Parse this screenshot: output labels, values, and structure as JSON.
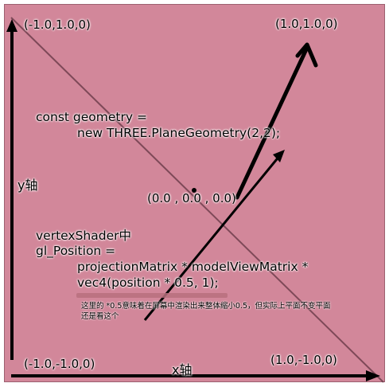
{
  "corners": {
    "top_left": "(-1.0,1.0,0)",
    "top_right": "(1.0,1.0,0)",
    "bottom_left": "(-1.0,-1.0,0)",
    "bottom_right": "(1.0,-1.0,0)"
  },
  "center_label": "(0.0 , 0.0 , 0.0)",
  "axes": {
    "y_label": "y轴",
    "x_label": "x轴"
  },
  "code_geometry": {
    "line1": "const geometry =",
    "line2": "new THREE.PlaneGeometry(2,2);"
  },
  "code_shader": {
    "line1": "vertexShader中",
    "line2": "gl_Position =",
    "line3": "projectionMatrix * modelViewMatrix *",
    "line4": "vec4(position * 0.5, 1);"
  },
  "note": "这里的 *0.5意味着在屏幕中渲染出来整体缩小0.5，但实际上平面不变平面还是看这个",
  "colors": {
    "background": "#d2879a",
    "highlight": "#b8707e",
    "line": "#000000"
  }
}
